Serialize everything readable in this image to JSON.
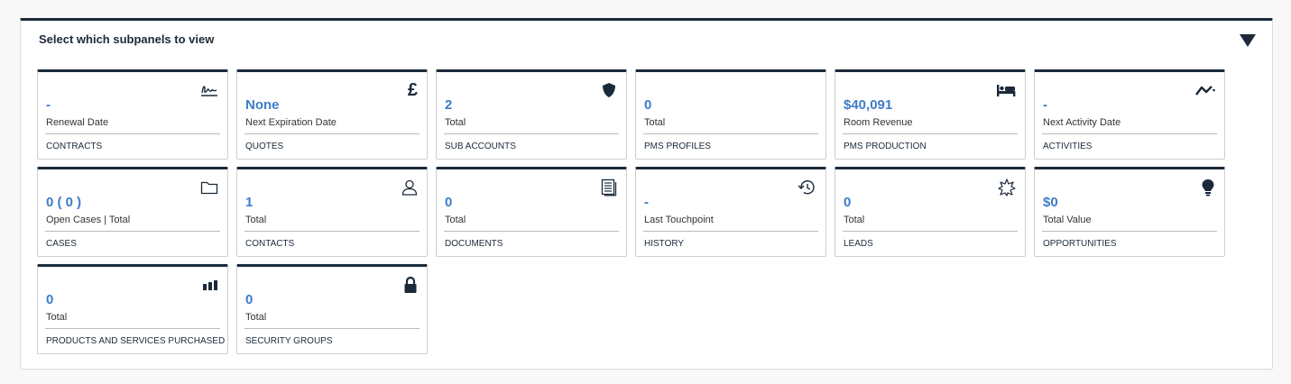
{
  "panel": {
    "title": "Select which subpanels to view"
  },
  "tiles": [
    {
      "value": "-",
      "label": "Renewal Date",
      "module": "CONTRACTS",
      "icon": "signature-icon"
    },
    {
      "value": "None",
      "label": "Next Expiration Date",
      "module": "QUOTES",
      "icon": "pound-icon",
      "glyph": "£"
    },
    {
      "value": "2",
      "label": "Total",
      "module": "SUB ACCOUNTS",
      "icon": "shield-icon"
    },
    {
      "value": "0",
      "label": "Total",
      "module": "PMS PROFILES",
      "icon": "none"
    },
    {
      "value": "$40,091",
      "label": "Room Revenue",
      "module": "PMS PRODUCTION",
      "icon": "bed-icon"
    },
    {
      "value": "-",
      "label": "Next Activity Date",
      "module": "ACTIVITIES",
      "icon": "activity-trend-icon"
    },
    {
      "value": "0 ( 0 )",
      "label": "Open Cases | Total",
      "module": "CASES",
      "icon": "folder-icon"
    },
    {
      "value": "1",
      "label": "Total",
      "module": "CONTACTS",
      "icon": "person-icon"
    },
    {
      "value": "0",
      "label": "Total",
      "module": "DOCUMENTS",
      "icon": "documents-icon"
    },
    {
      "value": "-",
      "label": "Last Touchpoint",
      "module": "HISTORY",
      "icon": "history-icon"
    },
    {
      "value": "0",
      "label": "Total",
      "module": "LEADS",
      "icon": "star-burst-icon"
    },
    {
      "value": "$0",
      "label": "Total Value",
      "module": "OPPORTUNITIES",
      "icon": "lightbulb-icon"
    },
    {
      "value": "0",
      "label": "Total",
      "module": "PRODUCTS AND SERVICES PURCHASED",
      "icon": "bar-chart-icon"
    },
    {
      "value": "0",
      "label": "Total",
      "module": "SECURITY GROUPS",
      "icon": "lock-icon"
    }
  ],
  "colors": {
    "accent": "#1b2a3a",
    "value": "#3d7cc9"
  }
}
